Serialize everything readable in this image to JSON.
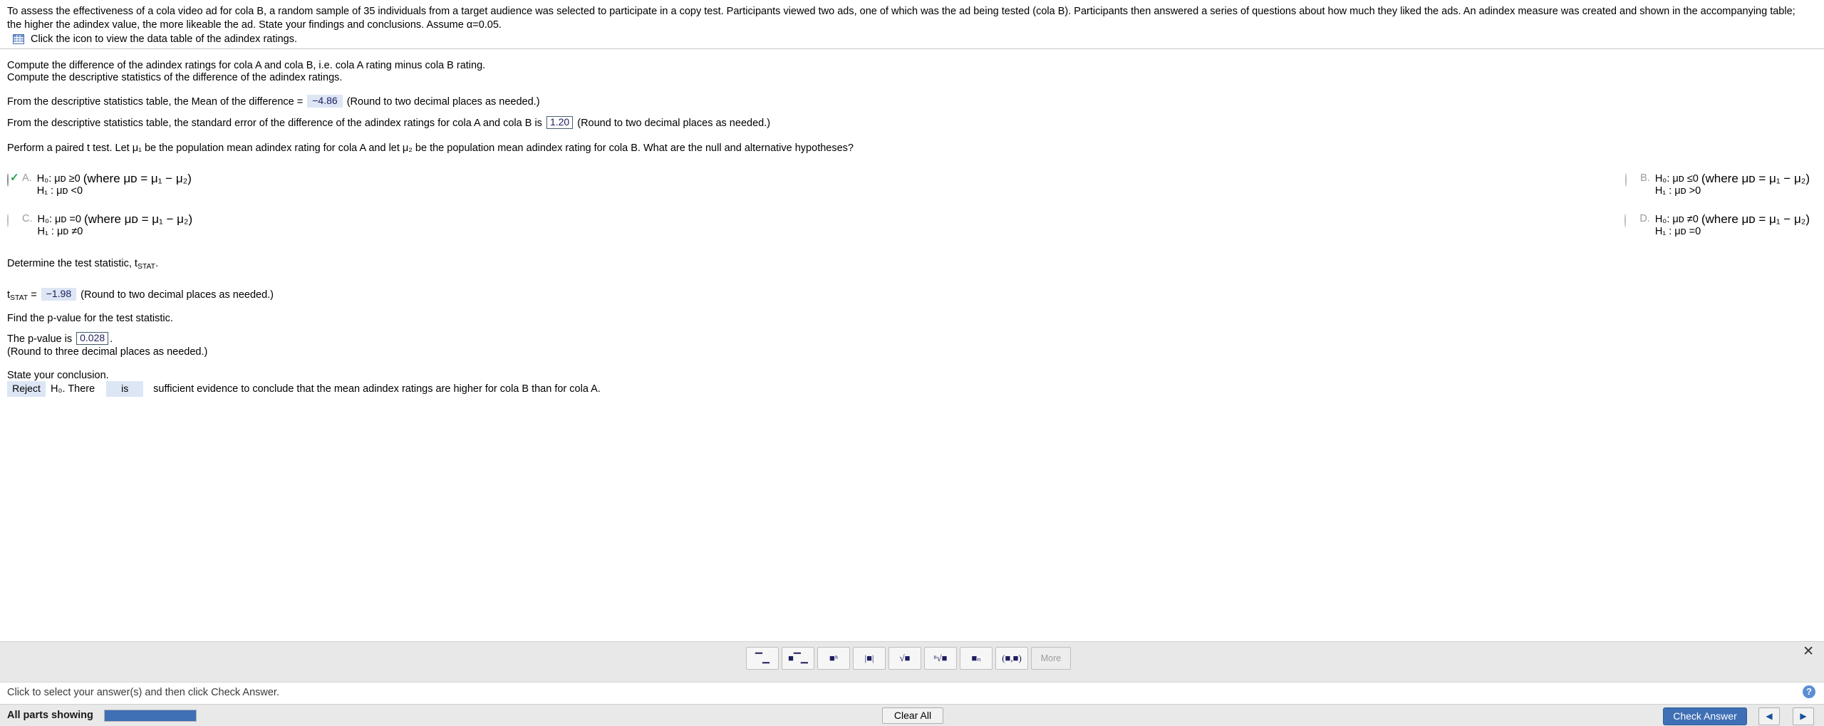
{
  "problem": {
    "statement": "To assess the effectiveness of a cola video ad for cola B, a random sample of 35 individuals from a target audience was selected to participate in a copy test. Participants viewed two ads, one of which was the ad being tested (cola B). Participants then answered a series of questions about how much they liked the ads. An adindex measure was created and shown in the accompanying table; the higher the adindex value, the more likeable the ad. State your findings and conclusions. Assume α=0.05.",
    "table_link_text": "Click the icon to view the data table of the adindex ratings.",
    "table_icon": "grid-table-icon"
  },
  "questions": {
    "compute_line1": "Compute the difference of the adindex ratings for cola A and cola B, i.e. cola A rating minus cola B rating.",
    "compute_line2": "Compute the descriptive statistics of the difference of the adindex ratings.",
    "mean_prefix": "From the descriptive statistics table, the Mean of the difference =",
    "mean_value": "−4.86",
    "mean_note": "(Round to two decimal places as needed.)",
    "stderr_prefix": "From the descriptive statistics table, the standard error of the difference of the adindex ratings for cola A and cola B is",
    "stderr_value": "1.20",
    "stderr_note": "(Round to two decimal places as needed.)",
    "paired_intro": "Perform a paired t test. Let μ₁ be the population mean adindex rating for cola A and let μ₂ be the population mean adindex rating for cola B. What are the null and alternative hypotheses?",
    "determine_stat": "Determine the test statistic, t",
    "determine_stat_sub": "STAT",
    "determine_stat_end": ".",
    "tstat_label": "t",
    "tstat_label_sub": "STAT",
    "tstat_eq": "=",
    "tstat_value": "−1.98",
    "tstat_note": "(Round to two decimal places as needed.)",
    "find_pvalue": "Find the p-value for the test statistic.",
    "pvalue_prefix": "The p-value is",
    "pvalue_value": "0.028",
    "pvalue_suffix": ".",
    "pvalue_note": "(Round to three decimal places as needed.)",
    "state_conclusion": "State your conclusion."
  },
  "choices": [
    {
      "letter": "A.",
      "selected": true,
      "null_hyp": "H₀: μᴅ ≥0",
      "where": "(where μᴅ = μ₁ − μ₂)",
      "alt_hyp": "H₁ : μᴅ <0"
    },
    {
      "letter": "B.",
      "selected": false,
      "null_hyp": "H₀: μᴅ ≤0",
      "where": "(where μᴅ = μ₁ − μ₂)",
      "alt_hyp": "H₁ : μᴅ >0"
    },
    {
      "letter": "C.",
      "selected": false,
      "null_hyp": "H₀: μᴅ =0",
      "where": "(where μᴅ = μ₁ − μ₂)",
      "alt_hyp": "H₁ : μᴅ ≠0"
    },
    {
      "letter": "D.",
      "selected": false,
      "null_hyp": "H₀: μᴅ ≠0",
      "where": "(where μᴅ = μ₁ − μ₂)",
      "alt_hyp": "H₁ : μᴅ =0"
    }
  ],
  "conclusion": {
    "reject_value": "Reject",
    "h0_text": "H₀. There",
    "is_value": "is",
    "tail_text": "sufficient evidence to conclude that the mean adindex ratings are higher for cola B than for cola A."
  },
  "palette": {
    "buttons": [
      {
        "name": "fraction-button",
        "label": "▔▁"
      },
      {
        "name": "mixed-fraction-button",
        "label": "■▔▁"
      },
      {
        "name": "exponent-button",
        "label": "■ⁿ"
      },
      {
        "name": "absolute-value-button",
        "label": "|■|"
      },
      {
        "name": "square-root-button",
        "label": "√■"
      },
      {
        "name": "nth-root-button",
        "label": "ⁿ√■"
      },
      {
        "name": "subscript-button",
        "label": "■ₙ"
      },
      {
        "name": "ordered-pair-button",
        "label": "(■,■)"
      }
    ],
    "more_label": "More",
    "close_label": "✕"
  },
  "status": {
    "hint": "Click to select your answer(s) and then click Check Answer.",
    "help_label": "?"
  },
  "footer": {
    "parts_label": "All parts showing",
    "progress_percent": 100,
    "clear_all_label": "Clear All",
    "check_answer_label": "Check Answer",
    "prev_label": "◀",
    "next_label": "▶"
  },
  "colors": {
    "accent": "#3f6fb5",
    "answer_highlight": "#dce6f4",
    "answer_text": "#1d1d5e",
    "check_green": "#22a14a"
  }
}
